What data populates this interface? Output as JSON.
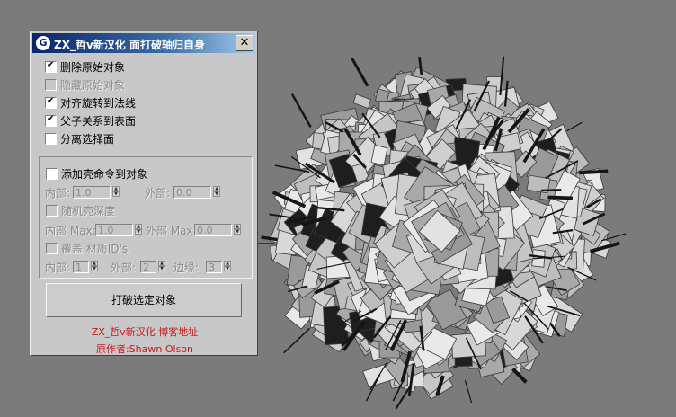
{
  "window": {
    "title": "ZX_哲v新汉化  面打破轴归自身",
    "icon": "3dsmax-logo-icon",
    "close_label": "✕"
  },
  "options": [
    {
      "label": "删除原始对象",
      "checked": true,
      "enabled": true
    },
    {
      "label": "隐藏原始对象",
      "checked": false,
      "enabled": false
    },
    {
      "label": "对齐旋转到法线",
      "checked": true,
      "enabled": true
    },
    {
      "label": "父子关系到表面",
      "checked": true,
      "enabled": true
    },
    {
      "label": "分离选择面",
      "checked": false,
      "enabled": true
    }
  ],
  "shell": {
    "add_label": "添加壳命令到对象",
    "add_checked": false,
    "inner_label": "内部:",
    "inner_value": "1.0",
    "outer_label": "外部:",
    "outer_value": "0.0",
    "random_label": "随机壳深度",
    "random_checked": false,
    "inner_max_label": "内部 Max:",
    "inner_max_value": "1.0",
    "outer_max_label": "外部 Max:",
    "outer_max_value": "0.0",
    "override_label": "覆盖 材质ID's",
    "override_checked": false,
    "id_inner_label": "内部:",
    "id_inner_value": "1",
    "id_outer_label": "外部:",
    "id_outer_value": "2",
    "id_edge_label": "边缘:",
    "id_edge_value": "3"
  },
  "action_button": "打破选定对象",
  "credits": {
    "line1": "ZX_哲v新汉化 博客地址",
    "line2": "原作者:Shawn Olson"
  },
  "colors": {
    "viewport_bg": "#7b7b7b",
    "panel_bg": "#c8c8c8",
    "credit_text": "#c8161e"
  }
}
